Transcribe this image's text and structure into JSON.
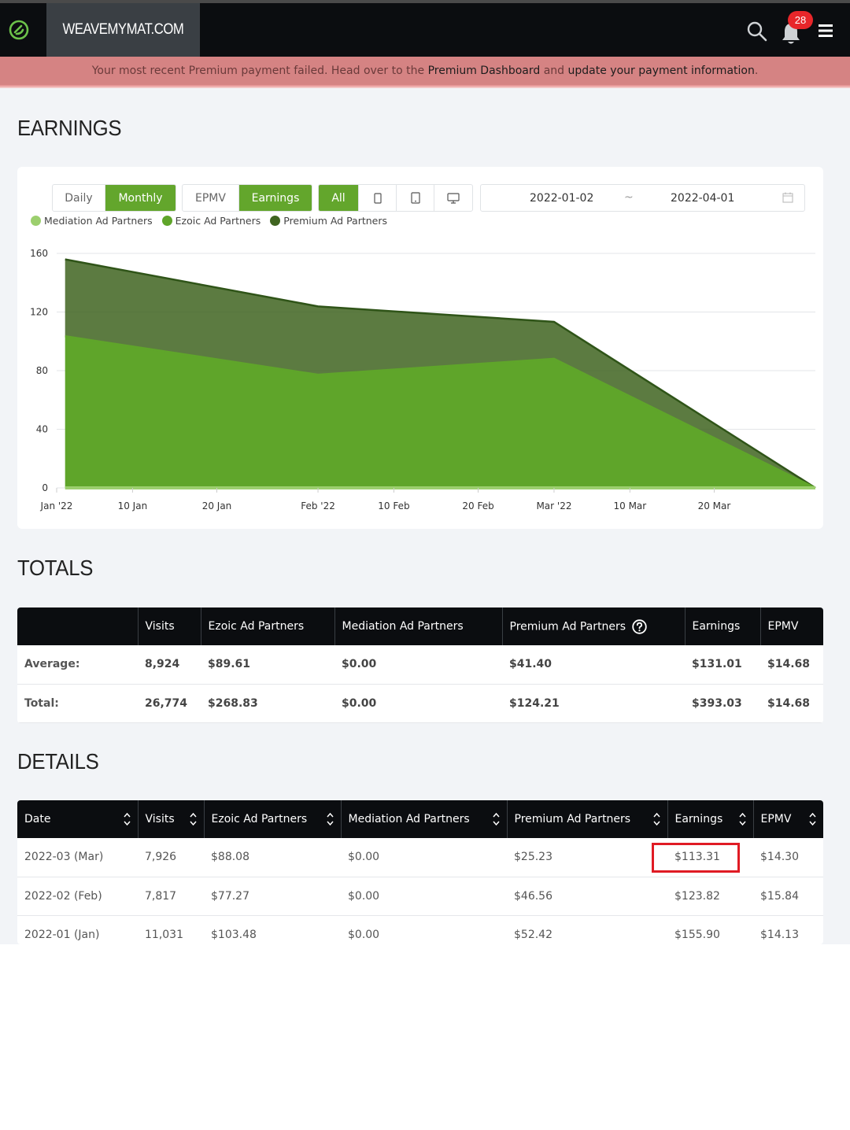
{
  "nav": {
    "site_name": "WEAVEMYMAT.COM",
    "notification_count": "28",
    "icons": [
      "ezoic-logo-icon",
      "search-icon",
      "bell-icon",
      "hamburger-menu-icon"
    ]
  },
  "alert": {
    "prefix": "Your most recent Premium payment failed. Head over to the ",
    "link1": "Premium Dashboard",
    "middle": " and ",
    "link2": "update your payment information",
    "suffix": "."
  },
  "earnings": {
    "title": "EARNINGS",
    "period_toggle": [
      "Daily",
      "Monthly"
    ],
    "period_selected": "Monthly",
    "metric_toggle": [
      "EPMV",
      "Earnings"
    ],
    "metric_selected": "Earnings",
    "device_all": "All",
    "device_icons": [
      "mobile-icon",
      "tablet-icon",
      "desktop-icon"
    ],
    "date_start": "2022-01-02",
    "date_sep": "~",
    "date_end": "2022-04-01"
  },
  "colors": {
    "accent": "#63a62c",
    "mediation": "#9ccf6e",
    "ezoic": "#5fa52a",
    "premium": "#3f6420",
    "alert_bg": "#d58383",
    "highlight": "#e01b24"
  },
  "chart_data": {
    "type": "area",
    "stacked": true,
    "x": [
      "2022-01-02",
      "2022-02-01",
      "2022-03-01",
      "2022-04-01"
    ],
    "x_tick_labels": [
      "Jan '22",
      "10 Jan",
      "20 Jan",
      "Feb '22",
      "10 Feb",
      "20 Feb",
      "Mar '22",
      "10 Mar",
      "20 Mar"
    ],
    "x_tick_dates": [
      "2022-01-01",
      "2022-01-10",
      "2022-01-20",
      "2022-02-01",
      "2022-02-10",
      "2022-02-20",
      "2022-03-01",
      "2022-03-10",
      "2022-03-20"
    ],
    "ylim": [
      0,
      160
    ],
    "y_ticks": [
      0,
      40,
      80,
      120,
      160
    ],
    "grid": true,
    "legend": "top-left",
    "series": [
      {
        "name": "Mediation Ad Partners",
        "values": [
          0,
          0,
          0,
          0
        ]
      },
      {
        "name": "Ezoic Ad Partners",
        "values": [
          103.48,
          77.27,
          88.08,
          0
        ]
      },
      {
        "name": "Premium Ad Partners",
        "values": [
          52.42,
          46.56,
          25.23,
          0
        ]
      }
    ]
  },
  "totals": {
    "title": "TOTALS",
    "headers": [
      "",
      "Visits",
      "Ezoic Ad Partners",
      "Mediation Ad Partners",
      "Premium Ad Partners",
      "Earnings",
      "EPMV"
    ],
    "rows": [
      [
        "Average:",
        "8,924",
        "$89.61",
        "$0.00",
        "$41.40",
        "$131.01",
        "$14.68"
      ],
      [
        "Total:",
        "26,774",
        "$268.83",
        "$0.00",
        "$124.21",
        "$393.03",
        "$14.68"
      ]
    ]
  },
  "details": {
    "title": "DETAILS",
    "headers": [
      "Date",
      "Visits",
      "Ezoic Ad Partners",
      "Mediation Ad Partners",
      "Premium Ad Partners",
      "Earnings",
      "EPMV"
    ],
    "rows": [
      [
        "2022-03 (Mar)",
        "7,926",
        "$88.08",
        "$0.00",
        "$25.23",
        "$113.31",
        "$14.30"
      ],
      [
        "2022-02 (Feb)",
        "7,817",
        "$77.27",
        "$0.00",
        "$46.56",
        "$123.82",
        "$15.84"
      ],
      [
        "2022-01 (Jan)",
        "11,031",
        "$103.48",
        "$0.00",
        "$52.42",
        "$155.90",
        "$14.13"
      ]
    ]
  }
}
